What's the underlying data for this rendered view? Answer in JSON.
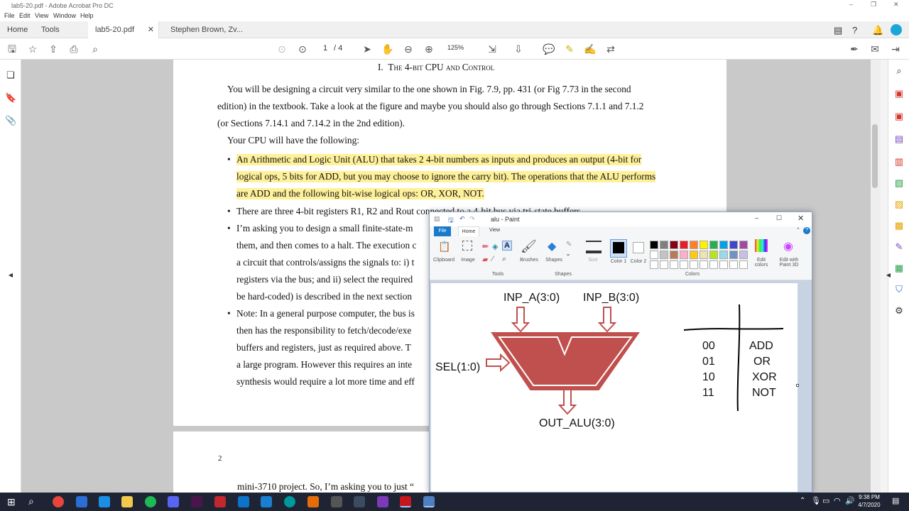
{
  "window_title": "lab5-20.pdf - Adobe Acrobat Pro DC",
  "menu": [
    "File",
    "Edit",
    "View",
    "Window",
    "Help"
  ],
  "tabs": {
    "home": "Home",
    "tools": "Tools",
    "doc1": "lab5-20.pdf",
    "doc2": "Stephen Brown, Zv..."
  },
  "toolbar": {
    "page_current": "1",
    "page_total": "/ 4",
    "zoom": "125%"
  },
  "doc": {
    "heading_num": "I.",
    "heading": "The 4-bit CPU and Control",
    "p1": "You will be designing a circuit very similar to the one shown in Fig. 7.9, pp. 431 (or Fig 7.73 in the second",
    "p2": "edition) in the textbook. Take a look at the figure and maybe you should also go through Sections 7.1.1 and 7.1.2",
    "p3": "(or Sections 7.14.1 and 7.14.2 in the 2nd edition).",
    "p4": "Your CPU will have the following:",
    "b1a": "An Arithmetic and Logic Unit (ALU) that takes 2 4-bit numbers as inputs and produces an output (4-bit for",
    "b1b": "logical ops, 5 bits for ADD, but you may choose to ignore the carry bit). The operations that the ALU performs",
    "b1c": "are ADD and the following bit-wise logical ops: OR, XOR, NOT.",
    "b2": "There are three 4-bit registers R1, R2 and Rout connected to a 4-bit bus via tri-state buffers.",
    "b3a": "I’m asking you to design a small finite-state-m",
    "b3b": "them, and then comes to a halt. The execution c",
    "b3c": "a circuit that controls/assigns the signals to: i) t",
    "b3d": "registers via the bus; and ii) select the required",
    "b3e": "be hard-coded) is described in the next section",
    "b4a": "Note: In a general purpose computer, the bus is",
    "b4b": "then has the responsibility to fetch/decode/exe",
    "b4c": "buffers and registers, just as required above. T",
    "b4d": "a large program. However this requires an inte",
    "b4e": "synthesis would require a lot more time and eff",
    "page_num": "2",
    "p2_line": "mini-3710 project. So, I’m asking you to just “"
  },
  "paint": {
    "title": "alu - Paint",
    "tabs": [
      "File",
      "Home",
      "View"
    ],
    "groups": {
      "clipboard": "Clipboard",
      "image": "Image",
      "tools": "Tools",
      "brushes": "Brushes",
      "shapes": "Shapes",
      "size": "Size",
      "color1": "Color 1",
      "color2": "Color 2",
      "colors": "Colors",
      "edit_colors": "Edit colors",
      "paint3d": "Edit with Paint 3D"
    },
    "palette": [
      "#000000",
      "#7f7f7f",
      "#880015",
      "#ed1c24",
      "#ff7f27",
      "#fff200",
      "#22b14c",
      "#00a2e8",
      "#3f48cc",
      "#a349a4",
      "#ffffff",
      "#c3c3c3",
      "#b97a57",
      "#ffaec9",
      "#ffc90e",
      "#efe4b0",
      "#b5e61d",
      "#99d9ea",
      "#7092be",
      "#c8bfe7"
    ],
    "diagram": {
      "inp_a": "INP_A(3:0)",
      "inp_b": "INP_B(3:0)",
      "sel": "SEL(1:0)",
      "out": "OUT_ALU(3:0)",
      "codes": [
        "00",
        "01",
        "10",
        "11"
      ],
      "ops": [
        "ADD",
        "OR",
        "XOR",
        "NOT"
      ],
      "alu_color": "#c0504d"
    }
  },
  "taskbar": {
    "time": "9:38 PM",
    "date": "4/7/2020"
  }
}
